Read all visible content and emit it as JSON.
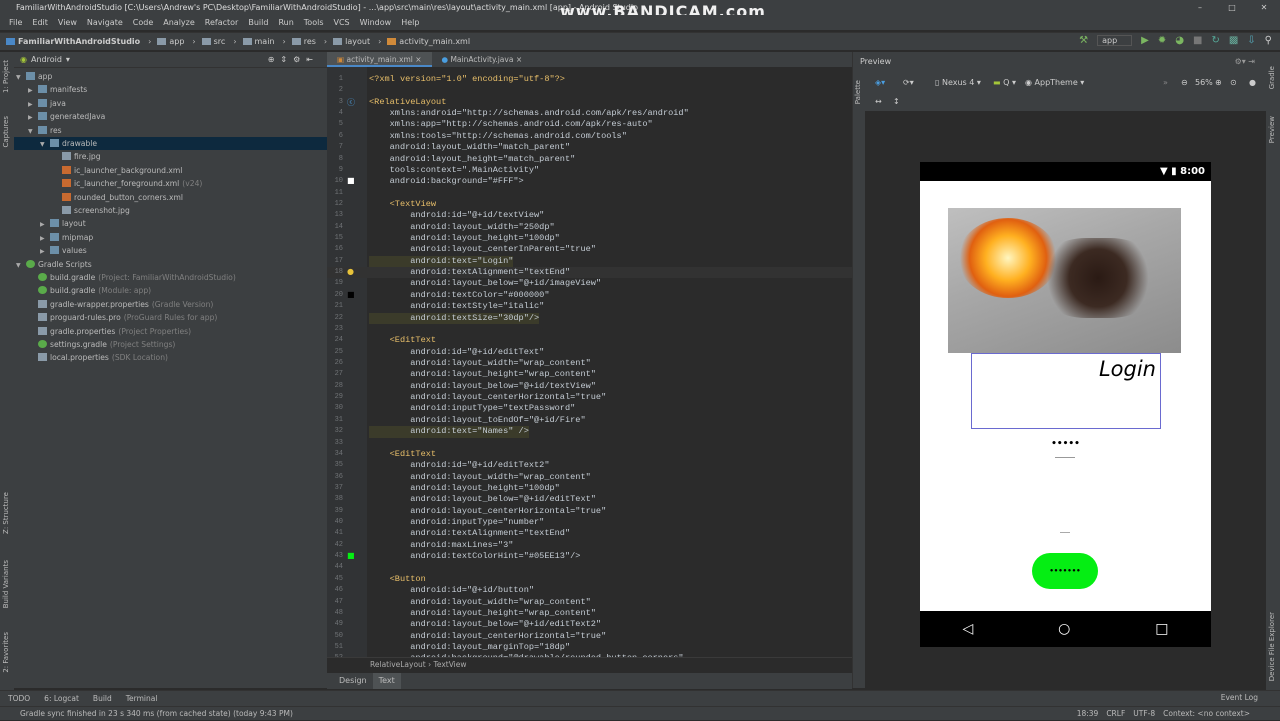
{
  "window": {
    "title": "FamiliarWithAndroidStudio [C:\\Users\\Andrew's PC\\Desktop\\FamiliarWithAndroidStudio] - ...\\app\\src\\main\\res\\layout\\activity_main.xml [app] - Android Studio",
    "watermark": "www.BANDICAM.com"
  },
  "menu": [
    "File",
    "Edit",
    "View",
    "Navigate",
    "Code",
    "Analyze",
    "Refactor",
    "Build",
    "Run",
    "Tools",
    "VCS",
    "Window",
    "Help"
  ],
  "breadcrumbs": [
    "FamiliarWithAndroidStudio",
    "app",
    "src",
    "main",
    "res",
    "layout",
    "activity_main.xml"
  ],
  "run_config": "app",
  "side_tabs": {
    "project": "1: Project",
    "captures": "Captures",
    "structure": "Z: Structure",
    "build_variants": "Build Variants",
    "favorites": "2: Favorites",
    "gradle": "Gradle",
    "preview": "Preview",
    "device_file_explorer": "Device File Explorer"
  },
  "project": {
    "view_mode": "Android",
    "tree": [
      {
        "label": "app",
        "hint": "",
        "depth": 0,
        "expanded": true
      },
      {
        "label": "manifests",
        "hint": "",
        "depth": 1,
        "expanded": false
      },
      {
        "label": "java",
        "hint": "",
        "depth": 1,
        "expanded": false
      },
      {
        "label": "generatedJava",
        "hint": "",
        "depth": 1,
        "expanded": false
      },
      {
        "label": "res",
        "hint": "",
        "depth": 1,
        "expanded": true
      },
      {
        "label": "drawable",
        "hint": "",
        "depth": 2,
        "expanded": true,
        "selected": true
      },
      {
        "label": "fire.jpg",
        "hint": "",
        "depth": 3
      },
      {
        "label": "ic_launcher_background.xml",
        "hint": "",
        "depth": 3
      },
      {
        "label": "ic_launcher_foreground.xml",
        "hint": "(v24)",
        "depth": 3
      },
      {
        "label": "rounded_button_corners.xml",
        "hint": "",
        "depth": 3
      },
      {
        "label": "screenshot.jpg",
        "hint": "",
        "depth": 3
      },
      {
        "label": "layout",
        "hint": "",
        "depth": 2,
        "expanded": false
      },
      {
        "label": "mipmap",
        "hint": "",
        "depth": 2,
        "expanded": false
      },
      {
        "label": "values",
        "hint": "",
        "depth": 2,
        "expanded": false
      },
      {
        "label": "Gradle Scripts",
        "hint": "",
        "depth": 0,
        "expanded": true
      },
      {
        "label": "build.gradle",
        "hint": "(Project: FamiliarWithAndroidStudio)",
        "depth": 1
      },
      {
        "label": "build.gradle",
        "hint": "(Module: app)",
        "depth": 1
      },
      {
        "label": "gradle-wrapper.properties",
        "hint": "(Gradle Version)",
        "depth": 1
      },
      {
        "label": "proguard-rules.pro",
        "hint": "(ProGuard Rules for app)",
        "depth": 1
      },
      {
        "label": "gradle.properties",
        "hint": "(Project Properties)",
        "depth": 1
      },
      {
        "label": "settings.gradle",
        "hint": "(Project Settings)",
        "depth": 1
      },
      {
        "label": "local.properties",
        "hint": "(SDK Location)",
        "depth": 1
      }
    ]
  },
  "editor": {
    "tabs": [
      {
        "label": "activity_main.xml",
        "active": true
      },
      {
        "label": "MainActivity.java",
        "active": false
      }
    ],
    "lines": [
      "<?xml version=\"1.0\" encoding=\"utf-8\"?>",
      "",
      "<RelativeLayout",
      "    xmlns:android=\"http://schemas.android.com/apk/res/android\"",
      "    xmlns:app=\"http://schemas.android.com/apk/res-auto\"",
      "    xmlns:tools=\"http://schemas.android.com/tools\"",
      "    android:layout_width=\"match_parent\"",
      "    android:layout_height=\"match_parent\"",
      "    tools:context=\".MainActivity\"",
      "    android:background=\"#FFF\">",
      "",
      "    <TextView",
      "        android:id=\"@+id/textView\"",
      "        android:layout_width=\"250dp\"",
      "        android:layout_height=\"100dp\"",
      "        android:layout_centerInParent=\"true\"",
      "        android:text=\"Login\"",
      "        android:textAlignment=\"textEnd\"",
      "        android:layout_below=\"@+id/imageView\"",
      "        android:textColor=\"#000000\"",
      "        android:textStyle=\"italic\"",
      "        android:textSize=\"30dp\"/>",
      "",
      "    <EditText",
      "        android:id=\"@+id/editText\"",
      "        android:layout_width=\"wrap_content\"",
      "        android:layout_height=\"wrap_content\"",
      "        android:layout_below=\"@+id/textView\"",
      "        android:layout_centerHorizontal=\"true\"",
      "        android:inputType=\"textPassword\"",
      "        android:layout_toEndOf=\"@+id/Fire\"",
      "        android:text=\"Names\" />",
      "",
      "    <EditText",
      "        android:id=\"@+id/editText2\"",
      "        android:layout_width=\"wrap_content\"",
      "        android:layout_height=\"100dp\"",
      "        android:layout_below=\"@+id/editText\"",
      "        android:layout_centerHorizontal=\"true\"",
      "        android:inputType=\"number\"",
      "        android:textAlignment=\"textEnd\"",
      "        android:maxLines=\"3\"",
      "        android:textColorHint=\"#05EE13\"/>",
      "",
      "    <Button",
      "        android:id=\"@+id/button\"",
      "        android:layout_width=\"wrap_content\"",
      "        android:layout_height=\"wrap_content\"",
      "        android:layout_below=\"@+id/editText2\"",
      "        android:layout_centerHorizontal=\"true\"",
      "        android:layout_marginTop=\"18dp\"",
      "        android:background=\"@drawable/rounded button corners\""
    ],
    "breadcrumb": [
      "RelativeLayout",
      "TextView"
    ],
    "bottom_tabs": [
      {
        "label": "Design",
        "active": false
      },
      {
        "label": "Text",
        "active": true
      }
    ]
  },
  "preview": {
    "title": "Preview",
    "device": "Nexus 4",
    "api": "Q",
    "theme": "AppTheme",
    "zoom": "56%",
    "phone": {
      "time": "8:00",
      "text": "Login",
      "password_dots": "•••••",
      "button_dots": "•••••••",
      "accent": "#05EE13"
    }
  },
  "tool_windows": [
    "TODO",
    "6: Logcat",
    "Build",
    "Terminal"
  ],
  "event_log": "Event Log",
  "status": {
    "message": "Gradle sync finished in 23 s 340 ms (from cached state) (today 9:43 PM)",
    "position": "18:39",
    "line_sep": "CRLF",
    "encoding": "UTF-8",
    "context": "Context: <no context>"
  }
}
